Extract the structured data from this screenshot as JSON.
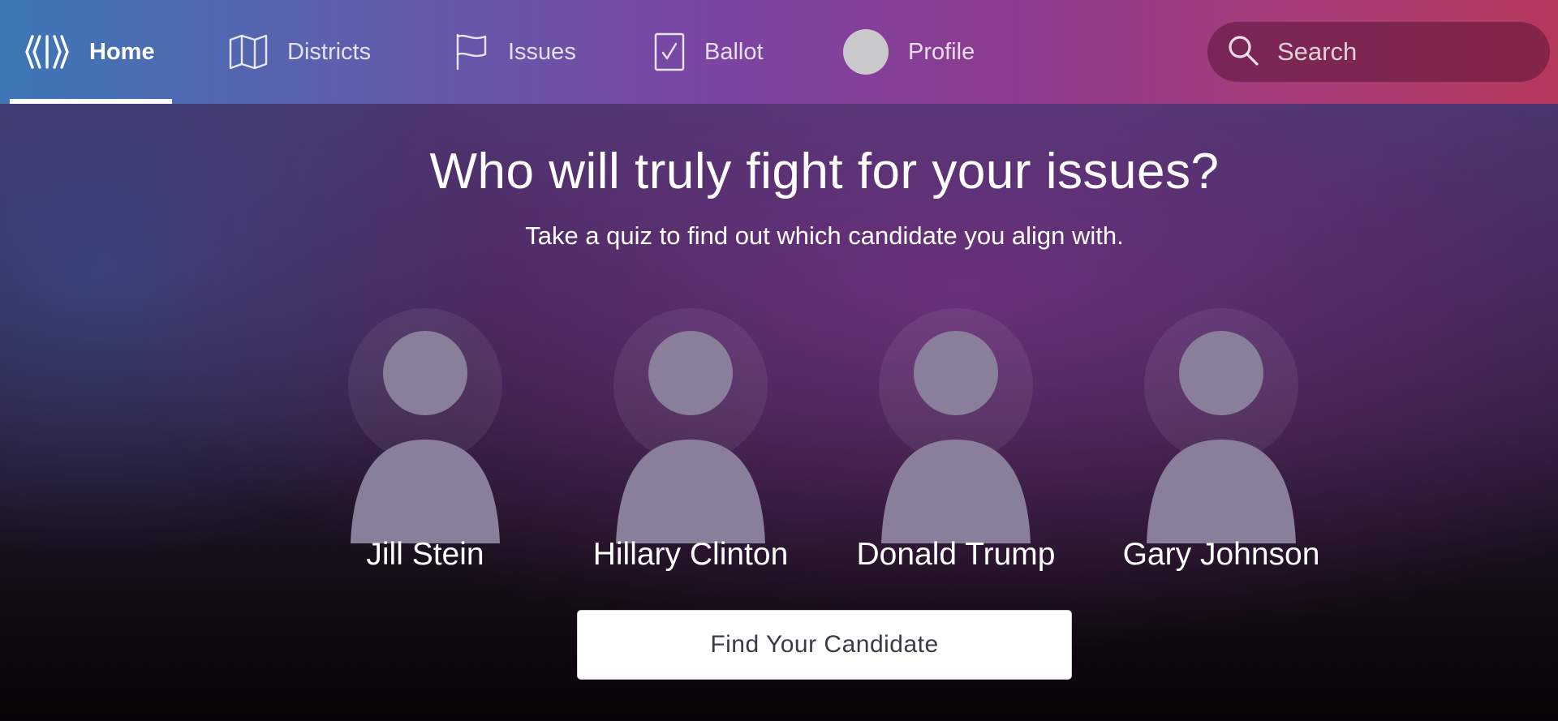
{
  "nav": {
    "items": [
      {
        "label": "Home",
        "icon": "signal-waves-icon",
        "active": true
      },
      {
        "label": "Districts",
        "icon": "map-icon",
        "active": false
      },
      {
        "label": "Issues",
        "icon": "flag-icon",
        "active": false
      },
      {
        "label": "Ballot",
        "icon": "checkbox-icon",
        "active": false
      },
      {
        "label": "Profile",
        "icon": "avatar-icon",
        "active": false
      }
    ],
    "search_placeholder": "Search"
  },
  "hero": {
    "title": "Who will truly fight for your issues?",
    "subtitle": "Take a quiz to find out which candidate you align with."
  },
  "candidates": [
    {
      "name": "Jill Stein"
    },
    {
      "name": "Hillary Clinton"
    },
    {
      "name": "Donald Trump"
    },
    {
      "name": "Gary Johnson"
    }
  ],
  "cta": {
    "label": "Find Your Candidate"
  },
  "colors": {
    "nav_gradient_start": "#3d77b6",
    "nav_gradient_mid": "#7a45a2",
    "nav_gradient_end": "#b6385c",
    "button_bg": "#ffffff",
    "button_text": "#3c3a45"
  }
}
